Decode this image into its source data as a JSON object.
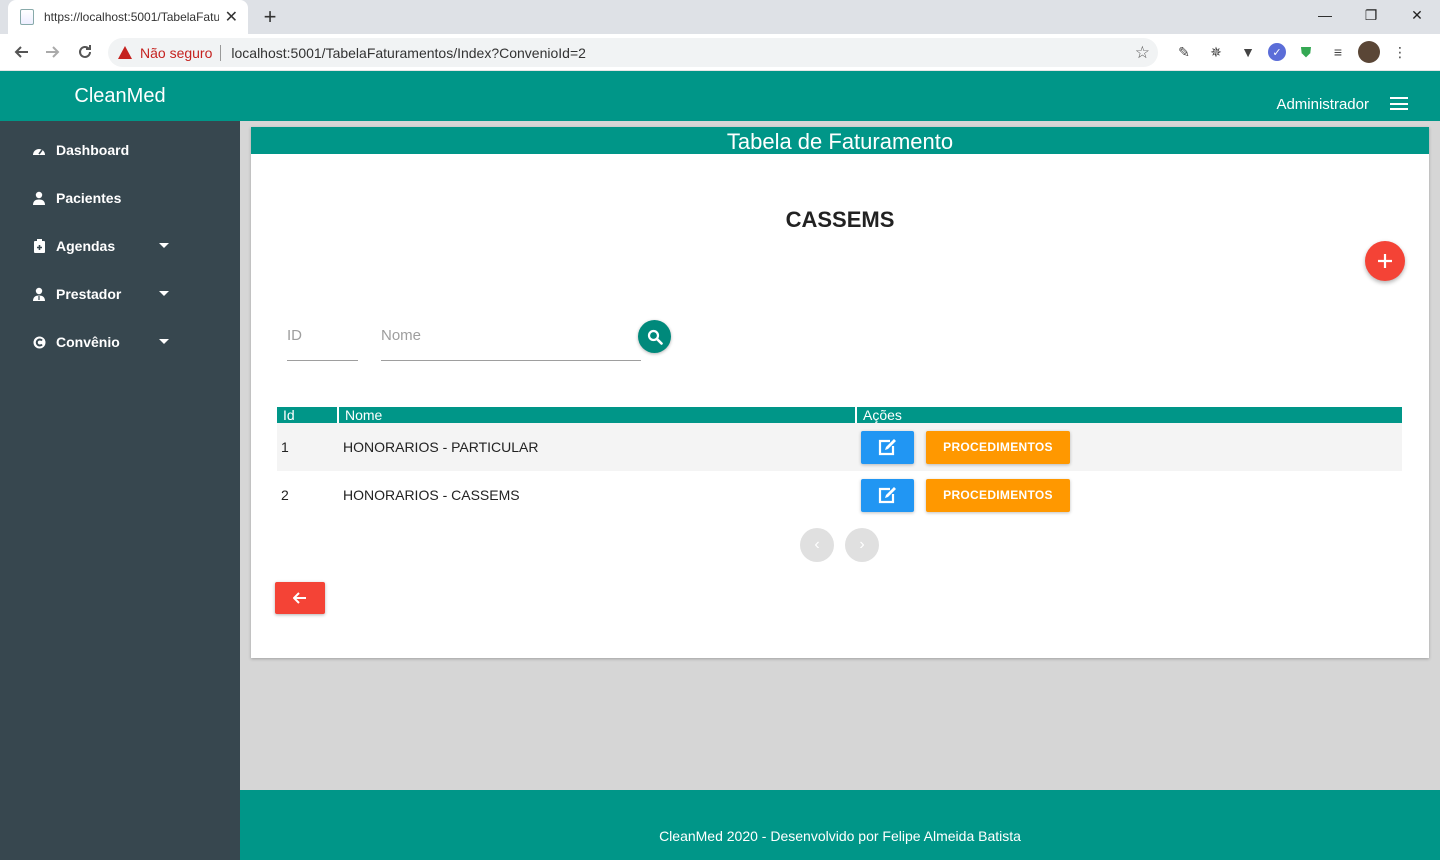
{
  "browser": {
    "tab_title": "https://localhost:5001/TabelaFatu",
    "security_label": "Não seguro",
    "url": "localhost:5001/TabelaFaturamentos/Index?ConvenioId=2"
  },
  "app": {
    "brand": "CleanMed",
    "user": "Administrador",
    "accent_color": "#009688",
    "sidebar_color": "#37474f"
  },
  "sidebar": {
    "items": [
      {
        "label": "Dashboard",
        "icon": "gauge-icon",
        "has_submenu": false
      },
      {
        "label": "Pacientes",
        "icon": "user-icon",
        "has_submenu": false
      },
      {
        "label": "Agendas",
        "icon": "clipboard-icon",
        "has_submenu": true
      },
      {
        "label": "Prestador",
        "icon": "user-doctor-icon",
        "has_submenu": true
      },
      {
        "label": "Convênio",
        "icon": "copyright-icon",
        "has_submenu": true
      }
    ]
  },
  "card": {
    "title": "Tabela de Faturamento",
    "convenio_name": "CASSEMS"
  },
  "filters": {
    "id_placeholder": "ID",
    "nome_placeholder": "Nome"
  },
  "table": {
    "headers": {
      "id": "Id",
      "nome": "Nome",
      "acoes": "Ações"
    },
    "rows": [
      {
        "id": "1",
        "nome": "HONORARIOS - PARTICULAR",
        "proc_label": "PROCEDIMENTOS"
      },
      {
        "id": "2",
        "nome": "HONORARIOS - CASSEMS",
        "proc_label": "PROCEDIMENTOS"
      }
    ]
  },
  "pagination": {
    "prev": "‹",
    "next": "›"
  },
  "footer": {
    "text": "CleanMed 2020 - Desenvolvido por Felipe Almeida Batista"
  }
}
